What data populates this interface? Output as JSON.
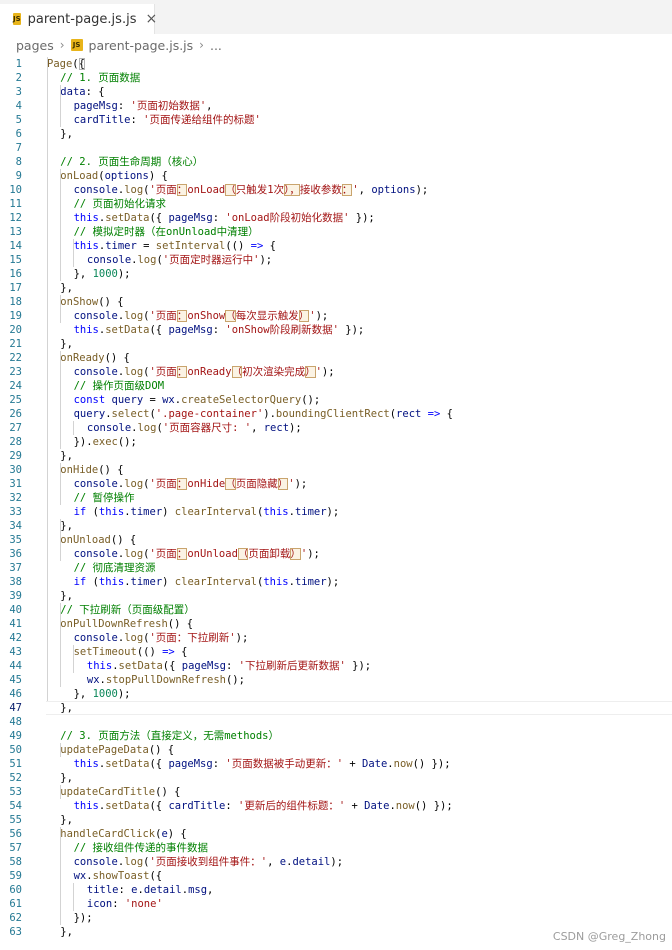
{
  "editor": {
    "tab": {
      "filename": "parent-page.js.js",
      "close": "×",
      "icon": "JS"
    },
    "breadcrumb": {
      "folder": "pages",
      "sep": "›",
      "file": "parent-page.js.js",
      "more": "..."
    },
    "current_line": 47
  },
  "colors": {
    "keyword": "#0000ff",
    "comment": "#008000",
    "string": "#a31515",
    "function": "#795e26",
    "property": "#001080",
    "number": "#098658",
    "line_number": "#237893",
    "js_icon": "#e8b41a"
  },
  "code_lines": [
    [
      [
        "fn",
        "Page"
      ],
      [
        "p",
        "("
      ],
      [
        "brace",
        "{"
      ]
    ],
    [
      [
        "cmt",
        "// 1. 页面数据"
      ]
    ],
    [
      [
        "prop",
        "data"
      ],
      [
        "p",
        ": {"
      ]
    ],
    [
      [
        "prop",
        "pageMsg"
      ],
      [
        "p",
        ": "
      ],
      [
        "str",
        "'页面初始数据'"
      ],
      [
        "p",
        ","
      ]
    ],
    [
      [
        "prop",
        "cardTitle"
      ],
      [
        "p",
        ": "
      ],
      [
        "str",
        "'页面传递给组件的标题'"
      ]
    ],
    [
      [
        "p",
        "},"
      ]
    ],
    [],
    [
      [
        "cmt",
        "// 2. 页面生命周期（核心）"
      ]
    ],
    [
      [
        "fn",
        "onLoad"
      ],
      [
        "p",
        "("
      ],
      [
        "prop",
        "options"
      ],
      [
        "p",
        ") {"
      ]
    ],
    [
      [
        "prop",
        "console"
      ],
      [
        "p",
        "."
      ],
      [
        "fn",
        "log"
      ],
      [
        "p",
        "("
      ],
      [
        "str",
        "'页面"
      ],
      [
        "mark",
        "："
      ],
      [
        "str",
        "onLoad"
      ],
      [
        "mark",
        "（"
      ],
      [
        "str",
        "只触发1次"
      ],
      [
        "mark",
        "），"
      ],
      [
        "str",
        "接收参数"
      ],
      [
        "mark",
        "："
      ],
      [
        "str",
        "'"
      ],
      [
        "p",
        ", "
      ],
      [
        "prop",
        "options"
      ],
      [
        "p",
        ");"
      ]
    ],
    [
      [
        "cmt",
        "// 页面初始化请求"
      ]
    ],
    [
      [
        "kw",
        "this"
      ],
      [
        "p",
        "."
      ],
      [
        "fn",
        "setData"
      ],
      [
        "p",
        "({ "
      ],
      [
        "prop",
        "pageMsg"
      ],
      [
        "p",
        ": "
      ],
      [
        "str",
        "'onLoad阶段初始化数据'"
      ],
      [
        "p",
        " });"
      ]
    ],
    [
      [
        "cmt",
        "// 模拟定时器（在onUnload中清理）"
      ]
    ],
    [
      [
        "kw",
        "this"
      ],
      [
        "p",
        "."
      ],
      [
        "prop",
        "timer"
      ],
      [
        "p",
        " = "
      ],
      [
        "fn",
        "setInterval"
      ],
      [
        "p",
        "(() "
      ],
      [
        "kw",
        "=>"
      ],
      [
        "p",
        " {"
      ]
    ],
    [
      [
        "prop",
        "console"
      ],
      [
        "p",
        "."
      ],
      [
        "fn",
        "log"
      ],
      [
        "p",
        "("
      ],
      [
        "str",
        "'页面定时器运行中'"
      ],
      [
        "p",
        ");"
      ]
    ],
    [
      [
        "p",
        "}, "
      ],
      [
        "num",
        "1000"
      ],
      [
        "p",
        ");"
      ]
    ],
    [
      [
        "p",
        "},"
      ]
    ],
    [
      [
        "fn",
        "onShow"
      ],
      [
        "p",
        "() {"
      ]
    ],
    [
      [
        "prop",
        "console"
      ],
      [
        "p",
        "."
      ],
      [
        "fn",
        "log"
      ],
      [
        "p",
        "("
      ],
      [
        "str",
        "'页面"
      ],
      [
        "mark",
        "："
      ],
      [
        "str",
        "onShow"
      ],
      [
        "mark",
        "（"
      ],
      [
        "str",
        "每次显示触发"
      ],
      [
        "mark",
        "）"
      ],
      [
        "str",
        "'"
      ],
      [
        "p",
        ");"
      ]
    ],
    [
      [
        "kw",
        "this"
      ],
      [
        "p",
        "."
      ],
      [
        "fn",
        "setData"
      ],
      [
        "p",
        "({ "
      ],
      [
        "prop",
        "pageMsg"
      ],
      [
        "p",
        ": "
      ],
      [
        "str",
        "'onShow阶段刷新数据'"
      ],
      [
        "p",
        " });"
      ]
    ],
    [
      [
        "p",
        "},"
      ]
    ],
    [
      [
        "fn",
        "onReady"
      ],
      [
        "p",
        "() {"
      ]
    ],
    [
      [
        "prop",
        "console"
      ],
      [
        "p",
        "."
      ],
      [
        "fn",
        "log"
      ],
      [
        "p",
        "("
      ],
      [
        "str",
        "'页面"
      ],
      [
        "mark",
        "："
      ],
      [
        "str",
        "onReady"
      ],
      [
        "mark",
        "（"
      ],
      [
        "str",
        "初次渲染完成"
      ],
      [
        "mark",
        "）"
      ],
      [
        "str",
        "'"
      ],
      [
        "p",
        ");"
      ]
    ],
    [
      [
        "cmt",
        "// 操作页面级DOM"
      ]
    ],
    [
      [
        "kw",
        "const"
      ],
      [
        "p",
        " "
      ],
      [
        "prop",
        "query"
      ],
      [
        "p",
        " = "
      ],
      [
        "prop",
        "wx"
      ],
      [
        "p",
        "."
      ],
      [
        "fn",
        "createSelectorQuery"
      ],
      [
        "p",
        "();"
      ]
    ],
    [
      [
        "prop",
        "query"
      ],
      [
        "p",
        "."
      ],
      [
        "fn",
        "select"
      ],
      [
        "p",
        "("
      ],
      [
        "str",
        "'.page-container'"
      ],
      [
        "p",
        ")."
      ],
      [
        "fn",
        "boundingClientRect"
      ],
      [
        "p",
        "("
      ],
      [
        "prop",
        "rect"
      ],
      [
        "p",
        " "
      ],
      [
        "kw",
        "=>"
      ],
      [
        "p",
        " {"
      ]
    ],
    [
      [
        "prop",
        "console"
      ],
      [
        "p",
        "."
      ],
      [
        "fn",
        "log"
      ],
      [
        "p",
        "("
      ],
      [
        "str",
        "'页面容器尺寸: '"
      ],
      [
        "p",
        ", "
      ],
      [
        "prop",
        "rect"
      ],
      [
        "p",
        ");"
      ]
    ],
    [
      [
        "p",
        "})."
      ],
      [
        "fn",
        "exec"
      ],
      [
        "p",
        "();"
      ]
    ],
    [
      [
        "p",
        "},"
      ]
    ],
    [
      [
        "fn",
        "onHide"
      ],
      [
        "p",
        "() {"
      ]
    ],
    [
      [
        "prop",
        "console"
      ],
      [
        "p",
        "."
      ],
      [
        "fn",
        "log"
      ],
      [
        "p",
        "("
      ],
      [
        "str",
        "'页面"
      ],
      [
        "mark",
        "："
      ],
      [
        "str",
        "onHide"
      ],
      [
        "mark",
        "（"
      ],
      [
        "str",
        "页面隐藏"
      ],
      [
        "mark",
        "）"
      ],
      [
        "str",
        "'"
      ],
      [
        "p",
        ");"
      ]
    ],
    [
      [
        "cmt",
        "// 暂停操作"
      ]
    ],
    [
      [
        "kw",
        "if"
      ],
      [
        "p",
        " ("
      ],
      [
        "kw",
        "this"
      ],
      [
        "p",
        "."
      ],
      [
        "prop",
        "timer"
      ],
      [
        "p",
        ") "
      ],
      [
        "fn",
        "clearInterval"
      ],
      [
        "p",
        "("
      ],
      [
        "kw",
        "this"
      ],
      [
        "p",
        "."
      ],
      [
        "prop",
        "timer"
      ],
      [
        "p",
        ");"
      ]
    ],
    [
      [
        "p",
        "},"
      ]
    ],
    [
      [
        "fn",
        "onUnload"
      ],
      [
        "p",
        "() {"
      ]
    ],
    [
      [
        "prop",
        "console"
      ],
      [
        "p",
        "."
      ],
      [
        "fn",
        "log"
      ],
      [
        "p",
        "("
      ],
      [
        "str",
        "'页面"
      ],
      [
        "mark",
        "："
      ],
      [
        "str",
        "onUnload"
      ],
      [
        "mark",
        "（"
      ],
      [
        "str",
        "页面卸载"
      ],
      [
        "mark",
        "）"
      ],
      [
        "str",
        "'"
      ],
      [
        "p",
        ");"
      ]
    ],
    [
      [
        "cmt",
        "// 彻底清理资源"
      ]
    ],
    [
      [
        "kw",
        "if"
      ],
      [
        "p",
        " ("
      ],
      [
        "kw",
        "this"
      ],
      [
        "p",
        "."
      ],
      [
        "prop",
        "timer"
      ],
      [
        "p",
        ") "
      ],
      [
        "fn",
        "clearInterval"
      ],
      [
        "p",
        "("
      ],
      [
        "kw",
        "this"
      ],
      [
        "p",
        "."
      ],
      [
        "prop",
        "timer"
      ],
      [
        "p",
        ");"
      ]
    ],
    [
      [
        "p",
        "},"
      ]
    ],
    [
      [
        "cmt",
        "// 下拉刷新（页面级配置）"
      ]
    ],
    [
      [
        "fn",
        "onPullDownRefresh"
      ],
      [
        "p",
        "() {"
      ]
    ],
    [
      [
        "prop",
        "console"
      ],
      [
        "p",
        "."
      ],
      [
        "fn",
        "log"
      ],
      [
        "p",
        "("
      ],
      [
        "str",
        "'页面：下拉刷新'"
      ],
      [
        "p",
        ");"
      ]
    ],
    [
      [
        "fn",
        "setTimeout"
      ],
      [
        "p",
        "(() "
      ],
      [
        "kw",
        "=>"
      ],
      [
        "p",
        " {"
      ]
    ],
    [
      [
        "kw",
        "this"
      ],
      [
        "p",
        "."
      ],
      [
        "fn",
        "setData"
      ],
      [
        "p",
        "({ "
      ],
      [
        "prop",
        "pageMsg"
      ],
      [
        "p",
        ": "
      ],
      [
        "str",
        "'下拉刷新后更新数据'"
      ],
      [
        "p",
        " });"
      ]
    ],
    [
      [
        "prop",
        "wx"
      ],
      [
        "p",
        "."
      ],
      [
        "fn",
        "stopPullDownRefresh"
      ],
      [
        "p",
        "();"
      ]
    ],
    [
      [
        "p",
        "}, "
      ],
      [
        "num",
        "1000"
      ],
      [
        "p",
        ");"
      ]
    ],
    [
      [
        "p",
        "},"
      ]
    ],
    [],
    [
      [
        "cmt",
        "// 3. 页面方法（直接定义，无需methods）"
      ]
    ],
    [
      [
        "fn",
        "updatePageData"
      ],
      [
        "p",
        "() {"
      ]
    ],
    [
      [
        "kw",
        "this"
      ],
      [
        "p",
        "."
      ],
      [
        "fn",
        "setData"
      ],
      [
        "p",
        "({ "
      ],
      [
        "prop",
        "pageMsg"
      ],
      [
        "p",
        ": "
      ],
      [
        "str",
        "'页面数据被手动更新：'"
      ],
      [
        "p",
        " + "
      ],
      [
        "prop",
        "Date"
      ],
      [
        "p",
        "."
      ],
      [
        "fn",
        "now"
      ],
      [
        "p",
        "() });"
      ]
    ],
    [
      [
        "p",
        "},"
      ]
    ],
    [
      [
        "fn",
        "updateCardTitle"
      ],
      [
        "p",
        "() {"
      ]
    ],
    [
      [
        "kw",
        "this"
      ],
      [
        "p",
        "."
      ],
      [
        "fn",
        "setData"
      ],
      [
        "p",
        "({ "
      ],
      [
        "prop",
        "cardTitle"
      ],
      [
        "p",
        ": "
      ],
      [
        "str",
        "'更新后的组件标题：'"
      ],
      [
        "p",
        " + "
      ],
      [
        "prop",
        "Date"
      ],
      [
        "p",
        "."
      ],
      [
        "fn",
        "now"
      ],
      [
        "p",
        "() });"
      ]
    ],
    [
      [
        "p",
        "},"
      ]
    ],
    [
      [
        "fn",
        "handleCardClick"
      ],
      [
        "p",
        "("
      ],
      [
        "prop",
        "e"
      ],
      [
        "p",
        ") {"
      ]
    ],
    [
      [
        "cmt",
        "// 接收组件传递的事件数据"
      ]
    ],
    [
      [
        "prop",
        "console"
      ],
      [
        "p",
        "."
      ],
      [
        "fn",
        "log"
      ],
      [
        "p",
        "("
      ],
      [
        "str",
        "'页面接收到组件事件：'"
      ],
      [
        "p",
        ", "
      ],
      [
        "prop",
        "e"
      ],
      [
        "p",
        "."
      ],
      [
        "prop",
        "detail"
      ],
      [
        "p",
        ");"
      ]
    ],
    [
      [
        "prop",
        "wx"
      ],
      [
        "p",
        "."
      ],
      [
        "fn",
        "showToast"
      ],
      [
        "p",
        "({"
      ]
    ],
    [
      [
        "prop",
        "title"
      ],
      [
        "p",
        ": "
      ],
      [
        "prop",
        "e"
      ],
      [
        "p",
        "."
      ],
      [
        "prop",
        "detail"
      ],
      [
        "p",
        "."
      ],
      [
        "prop",
        "msg"
      ],
      [
        "p",
        ","
      ]
    ],
    [
      [
        "prop",
        "icon"
      ],
      [
        "p",
        ": "
      ],
      [
        "str",
        "'none'"
      ]
    ],
    [
      [
        "p",
        "});"
      ]
    ],
    [
      [
        "p",
        "},"
      ]
    ]
  ],
  "watermark": "CSDN @Greg_Zhong"
}
